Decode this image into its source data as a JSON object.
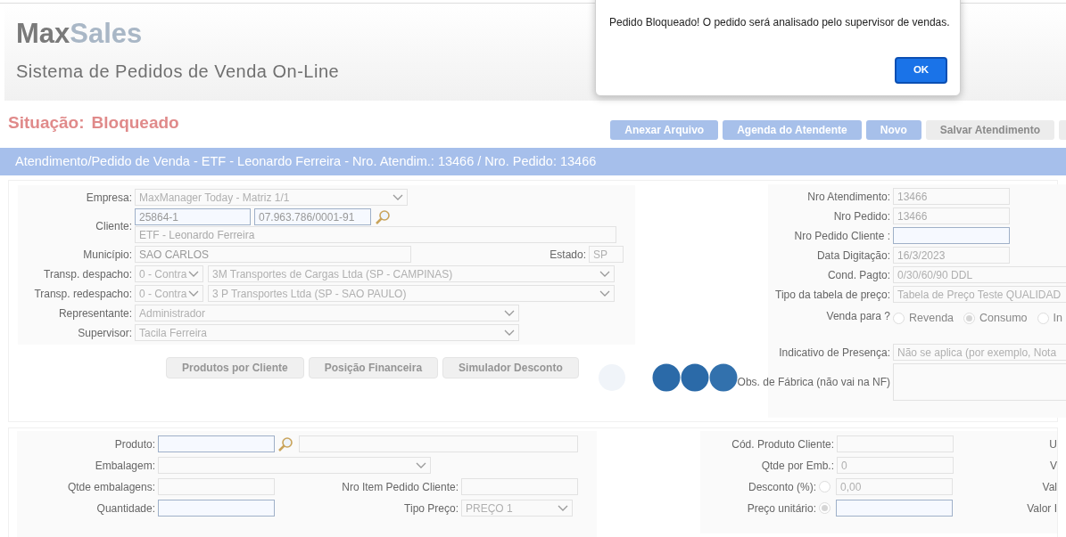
{
  "header": {
    "logo": [
      "Max",
      "Sales"
    ],
    "subtitle": "Sistema de Pedidos de Venda On-Line"
  },
  "status": {
    "label": "Situação:",
    "value": "Bloqueado"
  },
  "toolbar": [
    {
      "label": "Anexar Arquivo",
      "disabled": false
    },
    {
      "label": "Agenda do Atendente",
      "disabled": false
    },
    {
      "label": "Novo",
      "disabled": false
    },
    {
      "label": "Salvar Atendimento",
      "disabled": true
    }
  ],
  "title_bar": "Atendimento/Pedido de Venda - ETF - Leonardo Ferreira - Nro. Atendim.: 13466 / Nro. Pedido: 13466",
  "order": {
    "empresa": {
      "label": "Empresa:",
      "value": "MaxManager Today - Matriz 1/1"
    },
    "cliente": {
      "label": "Cliente:",
      "code": "25864-1",
      "document": "07.963.786/0001-91",
      "name": "ETF - Leonardo Ferreira"
    },
    "municipio": {
      "label": "Município:",
      "value": "SAO CARLOS"
    },
    "estado": {
      "label": "Estado:",
      "value": "SP"
    },
    "transports": [
      {
        "label": "Transp. despacho:",
        "code": "0 - Contra",
        "name": "3M Transportes de Cargas Ltda (SP - CAMPINAS)"
      },
      {
        "label": "Transp. redespacho:",
        "code": "0 - Contra",
        "name": "3 P Transportes Ltda (SP - SAO PAULO)"
      }
    ],
    "people": [
      {
        "label": "Representante:",
        "value": "Administrador"
      },
      {
        "label": "Supervisor:",
        "value": "Tacila Ferreira"
      }
    ],
    "buttons": [
      "Produtos por Cliente",
      "Posição Financeira",
      "Simulador Desconto"
    ]
  },
  "details": [
    {
      "kind": "text",
      "label": "Nro Atendimento:",
      "value": "13466"
    },
    {
      "kind": "text",
      "label": "Nro Pedido:",
      "value": "13466"
    },
    {
      "kind": "input",
      "label": "Nro Pedido Cliente :"
    },
    {
      "kind": "text",
      "label": "Data Digitação:",
      "value": "16/3/2023"
    },
    {
      "kind": "wide",
      "label": "Cond. Pagto:",
      "value": "0/30/60/90 DDL"
    },
    {
      "kind": "wide",
      "label": "Tipo da tabela de preço:",
      "value": "Tabela de Preço Teste QUALIDAD"
    },
    {
      "kind": "radio",
      "label": "Venda para ?",
      "options": [
        {
          "label": "Revenda",
          "selected": false
        },
        {
          "label": "Consumo",
          "selected": true
        },
        {
          "label": "In",
          "selected": false
        }
      ]
    },
    {
      "kind": "wide",
      "label": "Indicativo de Presença:",
      "value": "Não se aplica (por exemplo, Nota"
    },
    {
      "kind": "textarea",
      "label": "Obs. de Fábrica (não vai na NF)"
    }
  ],
  "item": {
    "produto": {
      "label": "Produto:"
    },
    "embalagem": {
      "label": "Embalagem:"
    },
    "qtde_embalagens": {
      "label": "Qtde embalagens:"
    },
    "quantidade": {
      "label": "Quantidade:"
    },
    "nro_item": {
      "label": "Nro Item Pedido Cliente:"
    },
    "tipo_preco": {
      "label": "Tipo Preço:",
      "value": "PREÇO 1"
    },
    "cod_produto": {
      "label": "Cód. Produto Cliente:"
    },
    "qtde_emb": {
      "label": "Qtde por Emb.:",
      "value": "0"
    },
    "desconto": {
      "label": "Desconto (%):",
      "value": "0,00",
      "selected": false
    },
    "preco": {
      "label": "Preço unitário:",
      "selected": true
    },
    "column_4": [
      "U",
      "V",
      "Val",
      "Valor I"
    ]
  },
  "dialog": {
    "message": "Pedido Bloqueado! O pedido será analisado pelo supervisor de vendas.",
    "button": "OK"
  }
}
